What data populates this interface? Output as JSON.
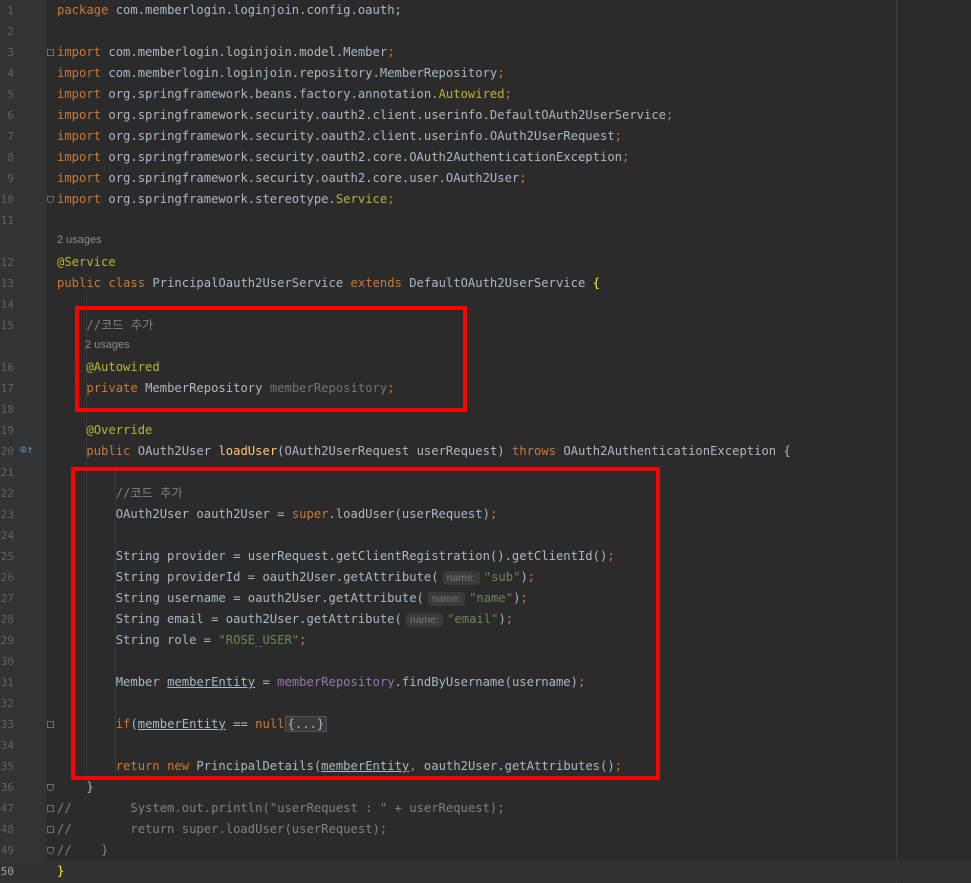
{
  "gutter_icons": {
    "override": "⊙↑"
  },
  "lines": [
    {
      "n": "1",
      "parts": [
        [
          "kw",
          "package "
        ],
        [
          "pkg",
          "com.memberlogin.loginjoin.config.oauth"
        ],
        [
          "",
          "; "
        ]
      ]
    },
    {
      "n": "2",
      "parts": []
    },
    {
      "n": "3",
      "parts": [
        [
          "kw",
          "import "
        ],
        [
          "pkg",
          "com.memberlogin.loginjoin.model.Member"
        ],
        [
          "kw",
          ";"
        ]
      ]
    },
    {
      "n": "4",
      "parts": [
        [
          "kw",
          "import "
        ],
        [
          "pkg",
          "com.memberlogin.loginjoin.repository.MemberRepository"
        ],
        [
          "kw",
          ";"
        ]
      ]
    },
    {
      "n": "5",
      "parts": [
        [
          "kw",
          "import "
        ],
        [
          "pkg",
          "org.springframework.beans.factory.annotation."
        ],
        [
          "ann",
          "Autowired"
        ],
        [
          "kw",
          ";"
        ]
      ]
    },
    {
      "n": "6",
      "parts": [
        [
          "kw",
          "import "
        ],
        [
          "pkg",
          "org.springframework.security.oauth2.client.userinfo.DefaultOAuth2UserService"
        ],
        [
          "kw",
          ";"
        ]
      ]
    },
    {
      "n": "7",
      "parts": [
        [
          "kw",
          "import "
        ],
        [
          "pkg",
          "org.springframework.security.oauth2.client.userinfo.OAuth2UserRequest"
        ],
        [
          "kw",
          ";"
        ]
      ]
    },
    {
      "n": "8",
      "parts": [
        [
          "kw",
          "import "
        ],
        [
          "pkg",
          "org.springframework.security.oauth2.core.OAuth2AuthenticationException"
        ],
        [
          "kw",
          ";"
        ]
      ]
    },
    {
      "n": "9",
      "parts": [
        [
          "kw",
          "import "
        ],
        [
          "pkg",
          "org.springframework.security.oauth2.core.user.OAuth2User"
        ],
        [
          "kw",
          ";"
        ]
      ]
    },
    {
      "n": "10",
      "parts": [
        [
          "kw",
          "import "
        ],
        [
          "pkg",
          "org.springframework.stereotype."
        ],
        [
          "ann",
          "Service"
        ],
        [
          "kw",
          ";"
        ]
      ]
    },
    {
      "n": "11",
      "parts": []
    },
    {
      "n": "12",
      "parts": [
        [
          "ann",
          "@Service"
        ]
      ]
    },
    {
      "n": "13",
      "parts": [
        [
          "kw",
          "public class "
        ],
        [
          "",
          "PrincipalOauth2UserService "
        ],
        [
          "kw",
          "extends "
        ],
        [
          "",
          "DefaultOAuth2UserService "
        ],
        [
          "brace-hl",
          "{"
        ]
      ]
    },
    {
      "n": "14",
      "parts": []
    },
    {
      "n": "15",
      "parts": [
        [
          "",
          "    "
        ],
        [
          "cmt",
          "//코드 추가"
        ]
      ]
    },
    {
      "n": "16",
      "parts": [
        [
          "",
          "    "
        ],
        [
          "ann",
          "@Autowired"
        ]
      ]
    },
    {
      "n": "17",
      "parts": [
        [
          "",
          "    "
        ],
        [
          "kw",
          "private "
        ],
        [
          "",
          "MemberRepository "
        ],
        [
          "unused",
          "memberRepository"
        ],
        [
          "kw",
          ";"
        ]
      ]
    },
    {
      "n": "18",
      "parts": []
    },
    {
      "n": "19",
      "parts": [
        [
          "",
          "    "
        ],
        [
          "ann",
          "@Override"
        ]
      ]
    },
    {
      "n": "20",
      "parts": [
        [
          "",
          "    "
        ],
        [
          "kw",
          "public "
        ],
        [
          "",
          "OAuth2User "
        ],
        [
          "fn",
          "loadUser"
        ],
        [
          "",
          "(OAuth2UserRequest userRequest) "
        ],
        [
          "kw",
          "throws "
        ],
        [
          "",
          "OAuth2AuthenticationException {"
        ]
      ]
    },
    {
      "n": "21",
      "parts": []
    },
    {
      "n": "22",
      "parts": [
        [
          "",
          "        "
        ],
        [
          "cmt",
          "//코드 추가"
        ]
      ]
    },
    {
      "n": "23",
      "parts": [
        [
          "",
          "        OAuth2User oauth2User = "
        ],
        [
          "kw",
          "super"
        ],
        [
          "",
          ".loadUser(userRequest)"
        ],
        [
          "kw",
          ";"
        ]
      ]
    },
    {
      "n": "24",
      "parts": []
    },
    {
      "n": "25",
      "parts": [
        [
          "",
          "        String provider = userRequest.getClientRegistration().getClientId()"
        ],
        [
          "kw",
          ";"
        ]
      ]
    },
    {
      "n": "26",
      "parts": [
        [
          "",
          "        String providerId = oauth2User.getAttribute("
        ],
        [
          "hint",
          "name:"
        ],
        [
          "str",
          "\"sub\""
        ],
        [
          "",
          ")"
        ],
        [
          "kw",
          ";"
        ]
      ]
    },
    {
      "n": "27",
      "parts": [
        [
          "",
          "        String username = oauth2User.getAttribute("
        ],
        [
          "hint",
          "name:"
        ],
        [
          "str",
          "\"name\""
        ],
        [
          "",
          ")"
        ],
        [
          "kw",
          ";"
        ]
      ]
    },
    {
      "n": "28",
      "parts": [
        [
          "",
          "        String email = oauth2User.getAttribute("
        ],
        [
          "hint",
          "name:"
        ],
        [
          "str",
          "\"email\""
        ],
        [
          "",
          ")"
        ],
        [
          "kw",
          ";"
        ]
      ]
    },
    {
      "n": "29",
      "parts": [
        [
          "",
          "        String role = "
        ],
        [
          "str",
          "\"ROSE_USER\""
        ],
        [
          "kw",
          ";"
        ]
      ]
    },
    {
      "n": "30",
      "parts": []
    },
    {
      "n": "31",
      "parts": [
        [
          "",
          "        Member "
        ],
        [
          "u",
          "memberEntity"
        ],
        [
          "",
          " = "
        ],
        [
          "fld",
          "memberRepository"
        ],
        [
          "",
          ".findByUsername(username)"
        ],
        [
          "kw",
          ";"
        ]
      ]
    },
    {
      "n": "32",
      "parts": []
    },
    {
      "n": "33",
      "parts": [
        [
          "",
          "        "
        ],
        [
          "kw",
          "if"
        ],
        [
          "",
          "("
        ],
        [
          "u",
          "memberEntity"
        ],
        [
          "",
          " == "
        ],
        [
          "kw",
          "null"
        ],
        [
          ") "
        ],
        [
          "folded",
          "{...}"
        ]
      ]
    },
    {
      "n": "34",
      "parts": []
    },
    {
      "n": "35",
      "parts": [
        [
          "",
          "        "
        ],
        [
          "kw",
          "return new "
        ],
        [
          "",
          "PrincipalDetails("
        ],
        [
          "u",
          "memberEntity"
        ],
        [
          "kw",
          ", "
        ],
        [
          "",
          "oauth2User.getAttributes()"
        ],
        [
          "kw",
          ";"
        ]
      ]
    },
    {
      "n": "36",
      "parts": [
        [
          "",
          "    }"
        ]
      ]
    },
    {
      "n": "47",
      "parts": [
        [
          "cmt",
          "//        System.out.println(\"userRequest : \" + userRequest);"
        ]
      ]
    },
    {
      "n": "48",
      "parts": [
        [
          "cmt",
          "//        return super.loadUser(userRequest);"
        ]
      ]
    },
    {
      "n": "49",
      "parts": [
        [
          "cmt",
          "//    }"
        ]
      ]
    },
    {
      "n": "50",
      "parts": [
        [
          "brace-hl",
          "}"
        ]
      ]
    }
  ],
  "usages": {
    "class": "2 usages",
    "field": "2 usages"
  }
}
